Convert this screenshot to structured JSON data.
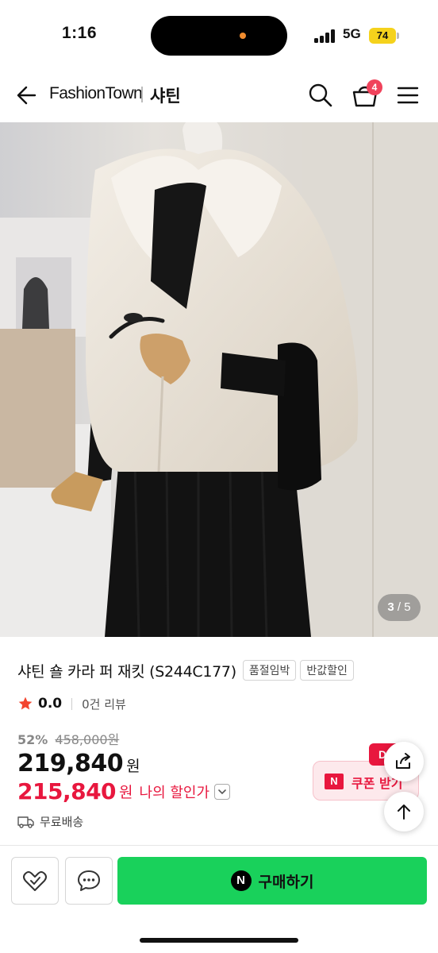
{
  "status_bar": {
    "time": "1:16",
    "network": "5G",
    "battery": "74",
    "battery_color": "#f5d21c"
  },
  "header": {
    "brand": "FashionTown",
    "shop_name": "샤틴",
    "cart_count": "4",
    "icons": [
      "arrow-left-icon",
      "search-icon",
      "shopping-basket-icon",
      "hamburger-menu-icon"
    ]
  },
  "gallery": {
    "current": "3",
    "separator": "/",
    "total": "5"
  },
  "product": {
    "title": "샤틴 숄 카라 퍼 재킷 (S244C177)",
    "tags": [
      "품절임박",
      "반값할인"
    ],
    "rating": "0.0",
    "review_count": "0건 리뷰",
    "discount_pct": "52%",
    "original_price": "458,000원",
    "price": "219,840",
    "price_unit": "원",
    "my_price": "215,840",
    "my_price_unit": "원",
    "my_price_label": "나의 할인가",
    "shipping": "무료배송"
  },
  "coupon": {
    "badge": "N",
    "label": "쿠폰 받기",
    "corner_tag": "D"
  },
  "bottom_bar": {
    "pay_badge": "N",
    "buy_label": "구매하기"
  },
  "colors": {
    "accent_red": "#e8173e",
    "buy_green": "#19d15b",
    "star": "#f2452f"
  }
}
